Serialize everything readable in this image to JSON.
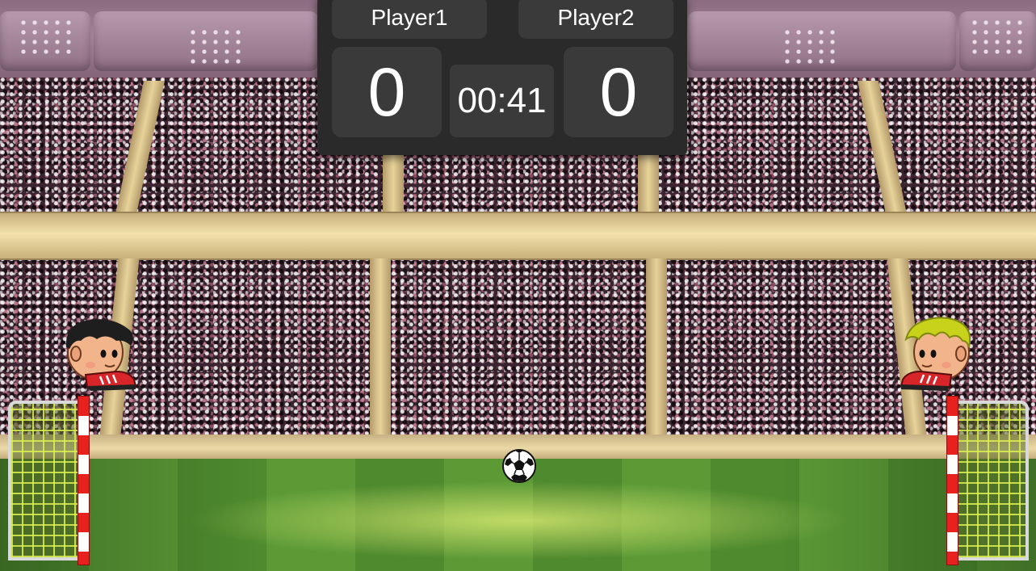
{
  "scoreboard": {
    "player1_name": "Player1",
    "player2_name": "Player2",
    "player1_score": "0",
    "player2_score": "0",
    "timer": "00:41"
  },
  "players": {
    "left": {
      "hair_color": "#1e1e1e",
      "boot_color": "#d8252a"
    },
    "right": {
      "hair_color": "#c9d21a",
      "boot_color": "#d8252a"
    }
  },
  "icons": {
    "ball": "soccer-ball-icon",
    "left_goal": "goal-net-icon",
    "right_goal": "goal-net-icon"
  },
  "colors": {
    "scoreboard_bg": "#2a2a2a",
    "tile_bg": "#3a3a3a",
    "post_red": "#e8201e",
    "pitch_green": "#5c9a36"
  }
}
